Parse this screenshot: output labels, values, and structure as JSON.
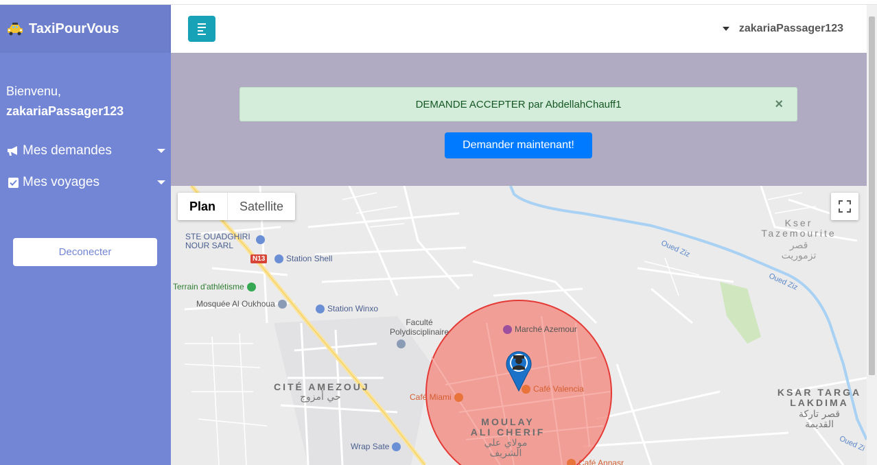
{
  "app": {
    "brand": "TaxiPourVous",
    "brand_icon": "taxi-icon"
  },
  "sidebar": {
    "welcome": "Bienvenu,",
    "username": "zakariaPassager123",
    "items": [
      {
        "label": "Mes demandes",
        "icon": "bullhorn-icon"
      },
      {
        "label": "Mes voyages",
        "icon": "check-square-icon"
      }
    ],
    "logout": "Deconecter"
  },
  "navbar": {
    "user": "zakariaPassager123"
  },
  "alert": {
    "message": "DEMANDE ACCEPTER par AbdellahChauff1",
    "close": "×"
  },
  "request_button": "Demander maintenant!",
  "map": {
    "types": [
      "Plan",
      "Satellite"
    ],
    "active_type": "Plan",
    "road_shield": "N13",
    "pois": {
      "ste": "STE OUADGHIRI NOUR SARL",
      "shell": "Station Shell",
      "terrain": "Terrain d'athlétisme",
      "mosquee": "Mosquée Al Oukhoua",
      "winxo": "Station Winxo",
      "faculte": "Faculté Polydisciplinaire",
      "marche": "Marché Azemour",
      "cafe_valencia": "Café Valencia",
      "cafe_miami": "Café Miami",
      "wrap": "Wrap Sate",
      "cafe_annasr": "Café Annasr"
    },
    "areas": {
      "cite": "CITÉ AMEZOUJ",
      "cite_ar": "حي أمزوج",
      "moulay": "MOULAY ALI CHERIF",
      "moulay_ar": "مولاي علي الشريف",
      "kser": "Kser Tazemourite",
      "kser_ar": "قصر تزموريت",
      "ksar": "KSAR TARGA LAKDIMA",
      "ksar_ar": "قصر تاركة القديمة"
    },
    "water": {
      "oued1": "Oued Ziz",
      "oued2": "Oued Ziz",
      "oued3": "Oued Zi"
    },
    "colors": {
      "radius_fill": "#f28b82",
      "radius_stroke": "#e53935",
      "marker": "#1a73c8"
    }
  }
}
